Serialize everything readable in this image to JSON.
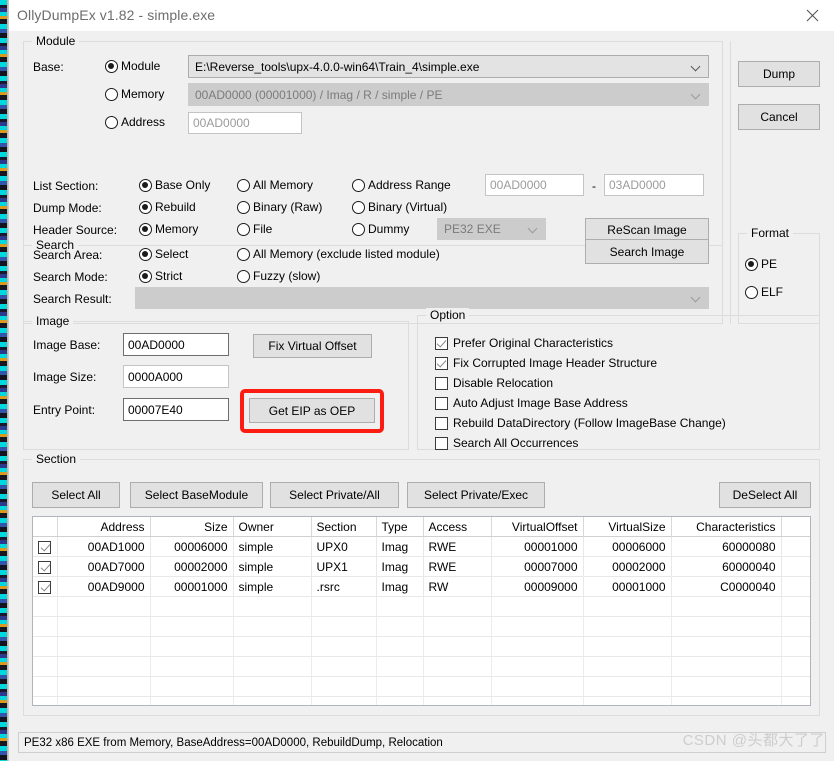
{
  "window": {
    "title": "OllyDumpEx v1.82 - simple.exe",
    "close_icon": "close-icon"
  },
  "module_group": {
    "legend": "Module",
    "base_label": "Base:",
    "base_options": [
      {
        "label": "Module",
        "selected": true
      },
      {
        "label": "Memory",
        "selected": false
      },
      {
        "label": "Address",
        "selected": false
      }
    ],
    "module_path": "E:\\Reverse_tools\\upx-4.0.0-win64\\Train_4\\simple.exe",
    "memory_value": "00AD0000 (00001000) / Imag / R   / simple / PE",
    "address_value": "00AD0000",
    "list_section_label": "List Section:",
    "list_section_options": [
      {
        "label": "Base Only",
        "selected": true
      },
      {
        "label": "All Memory",
        "selected": false
      },
      {
        "label": "Address Range",
        "selected": false
      }
    ],
    "range_start": "00AD0000",
    "range_dash": "-",
    "range_end": "03AD0000",
    "dump_mode_label": "Dump Mode:",
    "dump_mode_options": [
      {
        "label": "Rebuild",
        "selected": true
      },
      {
        "label": "Binary (Raw)",
        "selected": false
      },
      {
        "label": "Binary (Virtual)",
        "selected": false
      }
    ],
    "header_source_label": "Header Source:",
    "header_source_options": [
      {
        "label": "Memory",
        "selected": true
      },
      {
        "label": "File",
        "selected": false
      },
      {
        "label": "Dummy",
        "selected": false
      }
    ],
    "dummy_type": "PE32 EXE",
    "rescan_button": "ReScan Image"
  },
  "search_group": {
    "legend": "Search",
    "area_label": "Search Area:",
    "area_options": [
      {
        "label": "Select",
        "selected": true
      },
      {
        "label": "All Memory (exclude listed module)",
        "selected": false
      }
    ],
    "mode_label": "Search Mode:",
    "mode_options": [
      {
        "label": "Strict",
        "selected": true
      },
      {
        "label": "Fuzzy (slow)",
        "selected": false
      }
    ],
    "result_label": "Search Result:",
    "result_value": "",
    "search_button": "Search Image"
  },
  "actions": {
    "dump_button": "Dump",
    "cancel_button": "Cancel"
  },
  "format_group": {
    "legend": "Format",
    "options": [
      {
        "label": "PE",
        "selected": true
      },
      {
        "label": "ELF",
        "selected": false
      }
    ]
  },
  "image_group": {
    "legend": "Image",
    "image_base_label": "Image Base:",
    "image_base_value": "00AD0000",
    "image_size_label": "Image Size:",
    "image_size_value": "0000A000",
    "entry_point_label": "Entry Point:",
    "entry_point_value": "00007E40",
    "fix_virtual_offset_button": "Fix Virtual Offset",
    "get_eip_button": "Get EIP as OEP",
    "highlight_color": "#fc1c12"
  },
  "option_group": {
    "legend": "Option",
    "items": [
      {
        "label": "Prefer Original Characteristics",
        "checked": true
      },
      {
        "label": "Fix Corrupted Image Header Structure",
        "checked": true
      },
      {
        "label": "Disable Relocation",
        "checked": false
      },
      {
        "label": "Auto Adjust Image Base Address",
        "checked": false
      },
      {
        "label": "Rebuild DataDirectory (Follow ImageBase Change)",
        "checked": false
      },
      {
        "label": "Search All Occurrences",
        "checked": false
      }
    ]
  },
  "section_group": {
    "legend": "Section",
    "buttons": [
      "Select All",
      "Select BaseModule",
      "Select Private/All",
      "Select Private/Exec"
    ],
    "deselect_button": "DeSelect All",
    "columns": [
      "",
      "Address",
      "Size",
      "Owner",
      "Section",
      "Type",
      "Access",
      "VirtualOffset",
      "VirtualSize",
      "Characteristics",
      ""
    ],
    "rows": [
      {
        "checked": true,
        "address": "00AD1000",
        "size": "00006000",
        "owner": "simple",
        "section": "UPX0",
        "type": "Imag",
        "access": "RWE",
        "virtual_offset": "00001000",
        "virtual_size": "00006000",
        "characteristics": "60000080"
      },
      {
        "checked": true,
        "address": "00AD7000",
        "size": "00002000",
        "owner": "simple",
        "section": "UPX1",
        "type": "Imag",
        "access": "RWE",
        "virtual_offset": "00007000",
        "virtual_size": "00002000",
        "characteristics": "60000040"
      },
      {
        "checked": true,
        "address": "00AD9000",
        "size": "00001000",
        "owner": "simple",
        "section": ".rsrc",
        "type": "Imag",
        "access": "RW",
        "virtual_offset": "00009000",
        "virtual_size": "00001000",
        "characteristics": "C0000040"
      }
    ],
    "empty_row_count": 6
  },
  "status": {
    "text": "PE32 x86 EXE from Memory, BaseAddress=00AD0000, RebuildDump, Relocation",
    "watermark": "CSDN @头都大了了"
  }
}
